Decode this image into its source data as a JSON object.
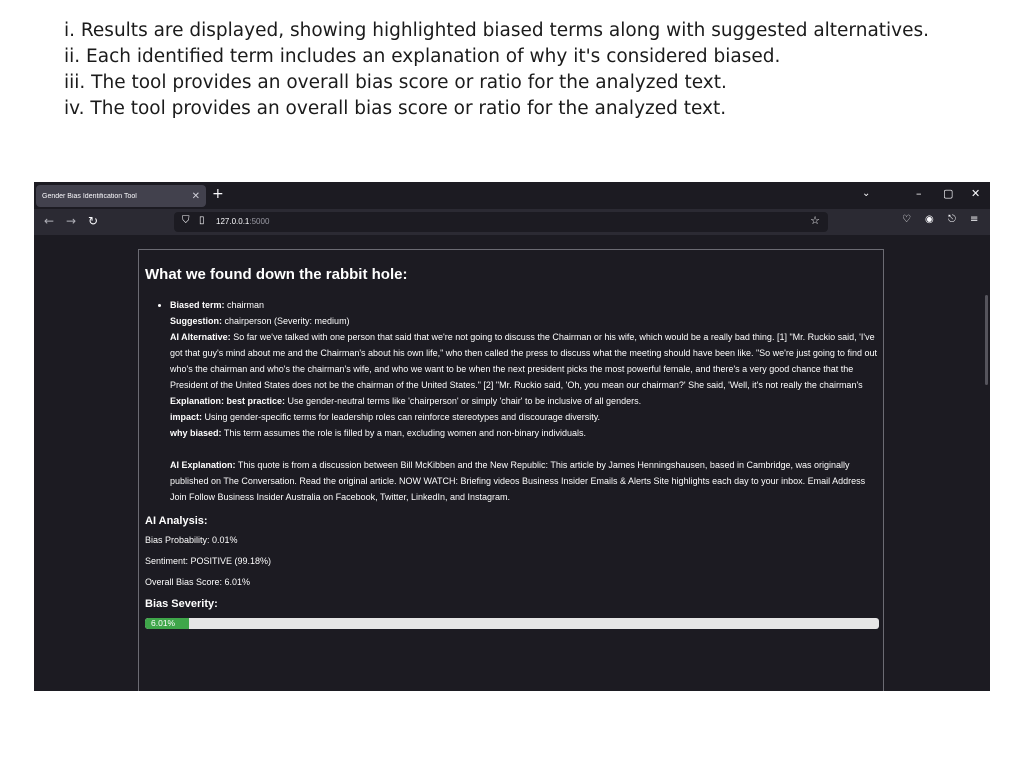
{
  "caption": {
    "lines": [
      "i. Results are displayed, showing highlighted biased terms along with suggested alternatives.",
      "ii. Each identified term includes an explanation of why it's considered biased.",
      "iii. The tool provides an overall bias score or ratio for the analyzed text.",
      "iv. The tool provides an overall bias score or ratio for the analyzed text."
    ]
  },
  "browser": {
    "tab_title": "Gender Bias Identification Tool",
    "url_host": "127.0.0.1",
    "url_port": ":5000"
  },
  "results": {
    "heading": "What we found down the rabbit hole:",
    "term": {
      "biased_term_label": "Biased term:",
      "biased_term": "chairman",
      "suggestion_label": "Suggestion:",
      "suggestion": "chairperson (Severity: medium)",
      "ai_alternative_label": "AI Alternative:",
      "ai_alternative": "So far we've talked with one person that said that we're not going to discuss the Chairman or his wife, which would be a really bad thing. [1] \"Mr. Ruckio said, 'I've got that guy's mind about me and the Chairman's about his own life,\" who then called the press to discuss what the meeting should have been like. \"So we're just going to find out who's the chairman and who's the chairman's wife, and who we want to be when the next president picks the most powerful female, and there's a very good chance that the President of the United States does not be the chairman of the United States.\" [2] \"Mr. Ruckio said, 'Oh, you mean our chairman?' She said, 'Well, it's not really the chairman's",
      "explanation_label": "Explanation: best practice:",
      "explanation": "Use gender-neutral terms like 'chairperson' or simply 'chair' to be inclusive of all genders.",
      "impact_label": "impact:",
      "impact": "Using gender-specific terms for leadership roles can reinforce stereotypes and discourage diversity.",
      "why_label": "why biased:",
      "why": "This term assumes the role is filled by a man, excluding women and non-binary individuals.",
      "ai_explanation_label": "AI Explanation:",
      "ai_explanation": "This quote is from a discussion between Bill McKibben and the New Republic: This article by James Henningshausen, based in Cambridge, was originally published on The Conversation. Read the original article. NOW WATCH: Briefing videos Business Insider Emails & Alerts Site highlights each day to your inbox. Email Address Join Follow Business Insider Australia on Facebook, Twitter, LinkedIn, and Instagram."
    },
    "analysis_heading": "AI Analysis:",
    "bias_probability": "Bias Probability: 0.01%",
    "sentiment": "Sentiment: POSITIVE (99.18%)",
    "overall_score": "Overall Bias Score: 6.01%",
    "severity_heading": "Bias Severity:",
    "severity_label": "6.01%",
    "severity_fraction": 0.0601,
    "severity_color": "#3fa64a"
  }
}
